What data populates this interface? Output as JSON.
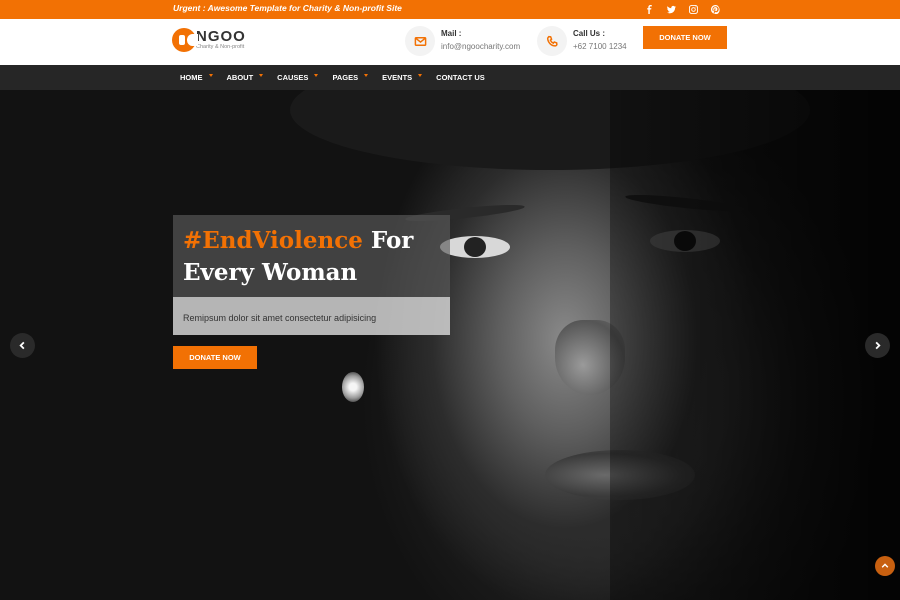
{
  "topbar": {
    "urgent_text": "Urgent : Awesome Template for Charity & Non-profit Site",
    "socials": [
      "facebook-icon",
      "twitter-icon",
      "instagram-icon",
      "pinterest-icon"
    ]
  },
  "header": {
    "logo_name": "NGOO",
    "logo_tagline": "Charity & Non-profit",
    "mail_label": "Mail :",
    "mail_value": "info@ngoocharity.com",
    "call_label": "Call Us :",
    "call_value": "+62 7100 1234",
    "donate_label": "DONATE NOW"
  },
  "nav": {
    "items": [
      {
        "label": "HOME",
        "dropdown": true
      },
      {
        "label": "ABOUT",
        "dropdown": true
      },
      {
        "label": "CAUSES",
        "dropdown": true
      },
      {
        "label": "PAGES",
        "dropdown": true
      },
      {
        "label": "EVENTS",
        "dropdown": true
      },
      {
        "label": "CONTACT US",
        "dropdown": false
      }
    ]
  },
  "hero": {
    "headline_highlight": "#EndViolence",
    "headline_rest": " For Every Woman",
    "subtext": "Remipsum dolor sit amet consectetur adipisicing",
    "donate_label": "DONATE NOW"
  },
  "colors": {
    "accent": "#f27104",
    "nav_bg": "#262626"
  }
}
